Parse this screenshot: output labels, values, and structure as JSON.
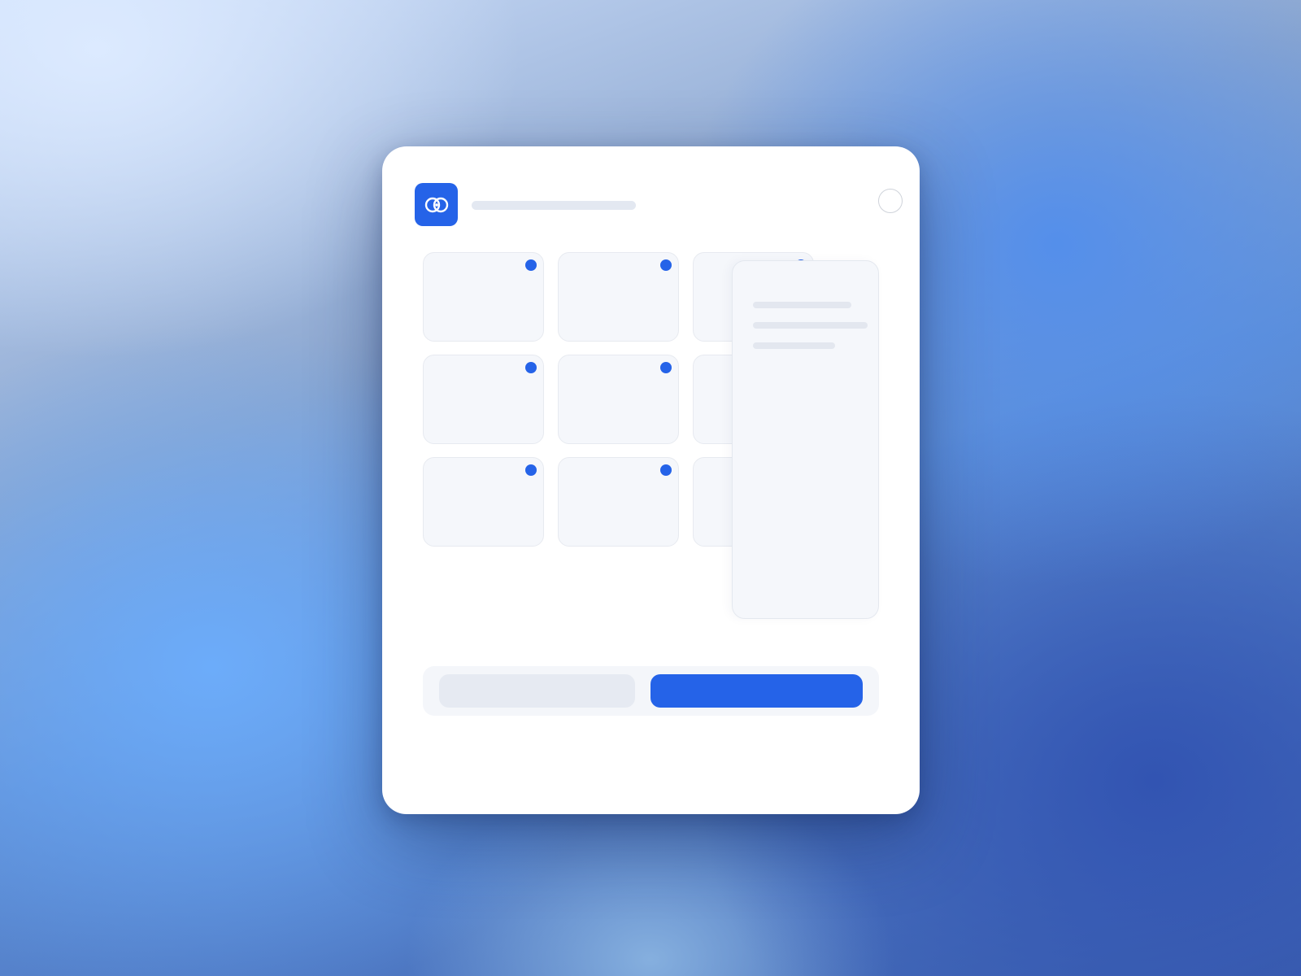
{
  "app": {
    "title": "",
    "logo_icon": "linked-rings-icon",
    "accent_color": "#2563e8"
  },
  "header": {
    "close_icon": "close-icon"
  },
  "grid": {
    "tiles": [
      {
        "label": "",
        "badge_color": "#2563e8"
      },
      {
        "label": "",
        "badge_color": "#2563e8"
      },
      {
        "label": "",
        "badge_color": "#2563e8"
      },
      {
        "label": "",
        "badge_color": "#2563e8"
      },
      {
        "label": "",
        "badge_color": "#2563e8"
      },
      {
        "label": "",
        "badge_color": "#2563e8"
      },
      {
        "label": "",
        "badge_color": "#2563e8"
      },
      {
        "label": "",
        "badge_color": "#2563e8"
      },
      {
        "label": "",
        "badge_color": "#2563e8"
      }
    ]
  },
  "side_panel": {
    "lines": [
      "",
      "",
      ""
    ]
  },
  "actions": {
    "secondary_label": "",
    "primary_label": "",
    "primary_color": "#2563e8"
  }
}
